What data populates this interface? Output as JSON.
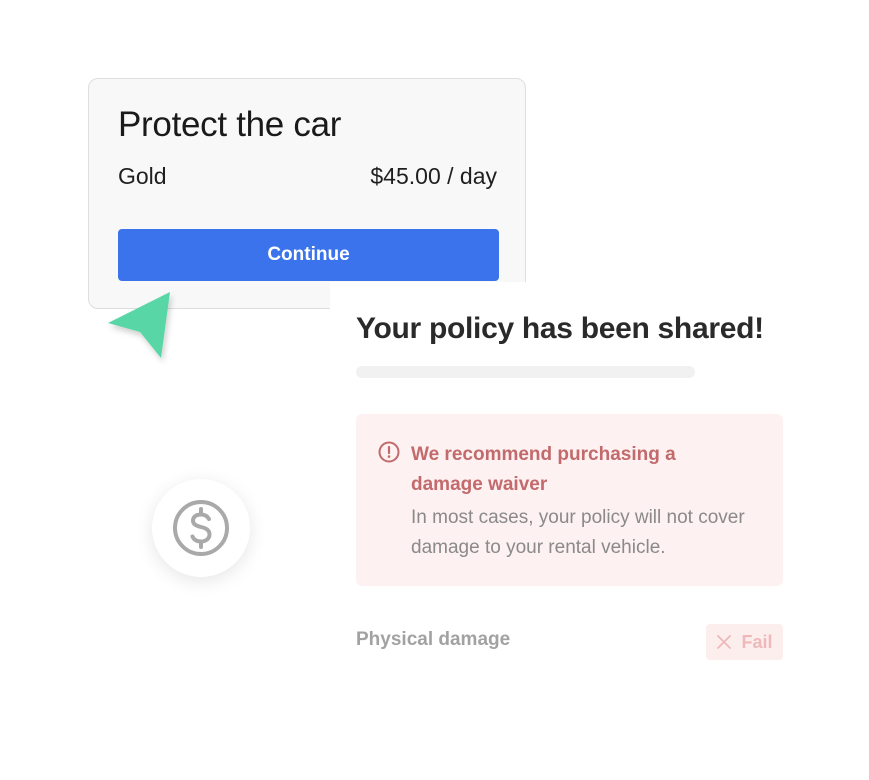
{
  "protect_card": {
    "title": "Protect the car",
    "plan_name": "Gold",
    "price": "$45.00 / day",
    "continue_label": "Continue"
  },
  "shared_panel": {
    "title": "Your policy has been shared!",
    "alert": {
      "heading": "We recommend purchasing a damage waiver",
      "body": "In most cases, your policy will not cover damage to your rental vehicle.",
      "icon": "alert-circle-icon"
    },
    "coverage": {
      "label": "Physical damage",
      "status": "Fail",
      "status_icon": "x-icon"
    }
  },
  "icons": {
    "cursor": "cursor-arrow-icon",
    "dollar": "dollar-circle-icon"
  },
  "colors": {
    "primary_button": "#3a73eb",
    "cursor": "#58d6a6",
    "alert_bg": "#fdf1f1",
    "alert_text": "#c26a6c",
    "fail_bg": "#fdeeee",
    "fail_text": "#efb9bb"
  }
}
